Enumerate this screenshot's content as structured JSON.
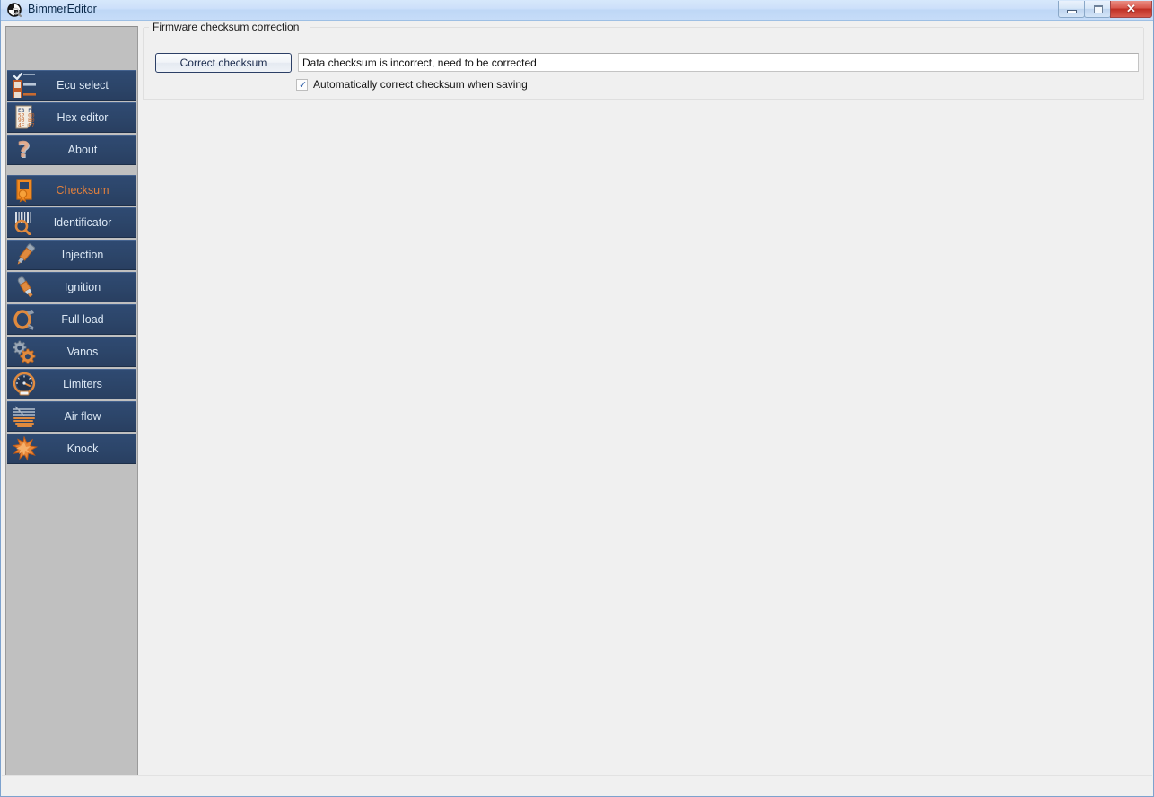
{
  "window": {
    "title": "BimmerEditor",
    "icon": "app-logo-icon",
    "controls": {
      "minimize_label": "",
      "maximize_label": "",
      "close_label": "✕"
    }
  },
  "sidebar": {
    "groups": [
      {
        "items": [
          {
            "label": "Ecu select",
            "icon": "checklist-icon",
            "selected": false
          },
          {
            "label": "Hex editor",
            "icon": "hex-document-icon",
            "selected": false
          },
          {
            "label": "About",
            "icon": "question-mark-icon",
            "selected": false
          }
        ]
      },
      {
        "items": [
          {
            "label": "Checksum",
            "icon": "certificate-seal-icon",
            "selected": true
          },
          {
            "label": "Identificator",
            "icon": "barcode-magnifier-icon",
            "selected": false
          },
          {
            "label": "Injection",
            "icon": "fuel-injector-icon",
            "selected": false
          },
          {
            "label": "Ignition",
            "icon": "spark-plug-icon",
            "selected": false
          },
          {
            "label": "Full load",
            "icon": "throttle-body-icon",
            "selected": false
          },
          {
            "label": "Vanos",
            "icon": "gears-icon",
            "selected": false
          },
          {
            "label": "Limiters",
            "icon": "speedometer-icon",
            "selected": false
          },
          {
            "label": "Air flow",
            "icon": "air-flow-icon",
            "selected": false
          },
          {
            "label": "Knock",
            "icon": "knock-burst-icon",
            "selected": false
          }
        ]
      }
    ]
  },
  "main": {
    "groupbox_title": "Firmware checksum correction",
    "correct_button_label": "Correct checksum",
    "status_value": "Data checksum is incorrect, need to be corrected",
    "status_placeholder": "",
    "auto_correct_label": "Automatically correct checksum when saving",
    "auto_correct_checked": true,
    "check_glyph": "✓"
  },
  "colors": {
    "sidebar_bg": "#c0c0c0",
    "nav_item_bg": "#2c4569",
    "nav_text": "#dce8f5",
    "nav_selected_text": "#e2803c",
    "titlebar": "#c6dcf8",
    "close_button": "#bf2f24",
    "content_bg": "#f0f0f0",
    "accent_orange": "#e2803c"
  },
  "statusbar": {
    "text": ""
  }
}
